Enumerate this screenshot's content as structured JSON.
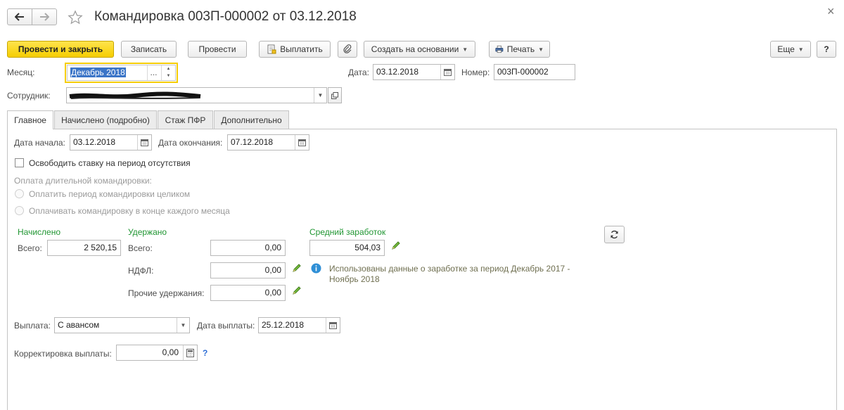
{
  "window": {
    "title": "Командировка 003П-000002 от 03.12.2018",
    "close_glyph": "×"
  },
  "toolbar": {
    "post_close": "Провести и закрыть",
    "save": "Записать",
    "post": "Провести",
    "pay": "Выплатить",
    "create_based": "Создать на основании",
    "print": "Печать",
    "more": "Еще",
    "help": "?"
  },
  "header": {
    "month_label": "Месяц:",
    "month_value": "Декабрь 2018",
    "month_select_glyph": "...",
    "date_label": "Дата:",
    "date_value": "03.12.2018",
    "number_label": "Номер:",
    "number_value": "003П-000002",
    "employee_label": "Сотрудник:"
  },
  "tabs": [
    {
      "label": "Главное",
      "active": true
    },
    {
      "label": "Начислено (подробно)",
      "active": false
    },
    {
      "label": "Стаж ПФР",
      "active": false
    },
    {
      "label": "Дополнительно",
      "active": false
    }
  ],
  "main": {
    "start_label": "Дата начала:",
    "start_value": "03.12.2018",
    "end_label": "Дата окончания:",
    "end_value": "07.12.2018",
    "free_rate_label": "Освободить ставку на период отсутствия",
    "free_rate_checked": false,
    "long_trip_label": "Оплата длительной командировки:",
    "long_trip_opt1": "Оплатить период командировки целиком",
    "long_trip_opt2": "Оплачивать командировку в конце каждого месяца",
    "accrued_header": "Начислено",
    "accrued_total_label": "Всего:",
    "accrued_total_value": "2 520,15",
    "withheld_header": "Удержано",
    "withheld_total_label": "Всего:",
    "withheld_total_value": "0,00",
    "ndfl_label": "НДФЛ:",
    "ndfl_value": "0,00",
    "other_label": "Прочие удержания:",
    "other_value": "0,00",
    "avg_header": "Средний заработок",
    "avg_value": "504,03",
    "info_text_line1": "Использованы данные о заработке за период Декабрь 2017 -",
    "info_text_line2": "Ноябрь 2018",
    "payout_label": "Выплата:",
    "payout_value": "С авансом",
    "payout_date_label": "Дата выплаты:",
    "payout_date_value": "25.12.2018",
    "correction_label": "Корректировка выплаты:",
    "correction_value": "0,00",
    "correction_help": "?"
  },
  "colors": {
    "primary_button": "#f5cd00",
    "section_header_green": "#219633",
    "info_icon_blue": "#2f8fd6",
    "pencil_green": "#5a9e2c"
  }
}
